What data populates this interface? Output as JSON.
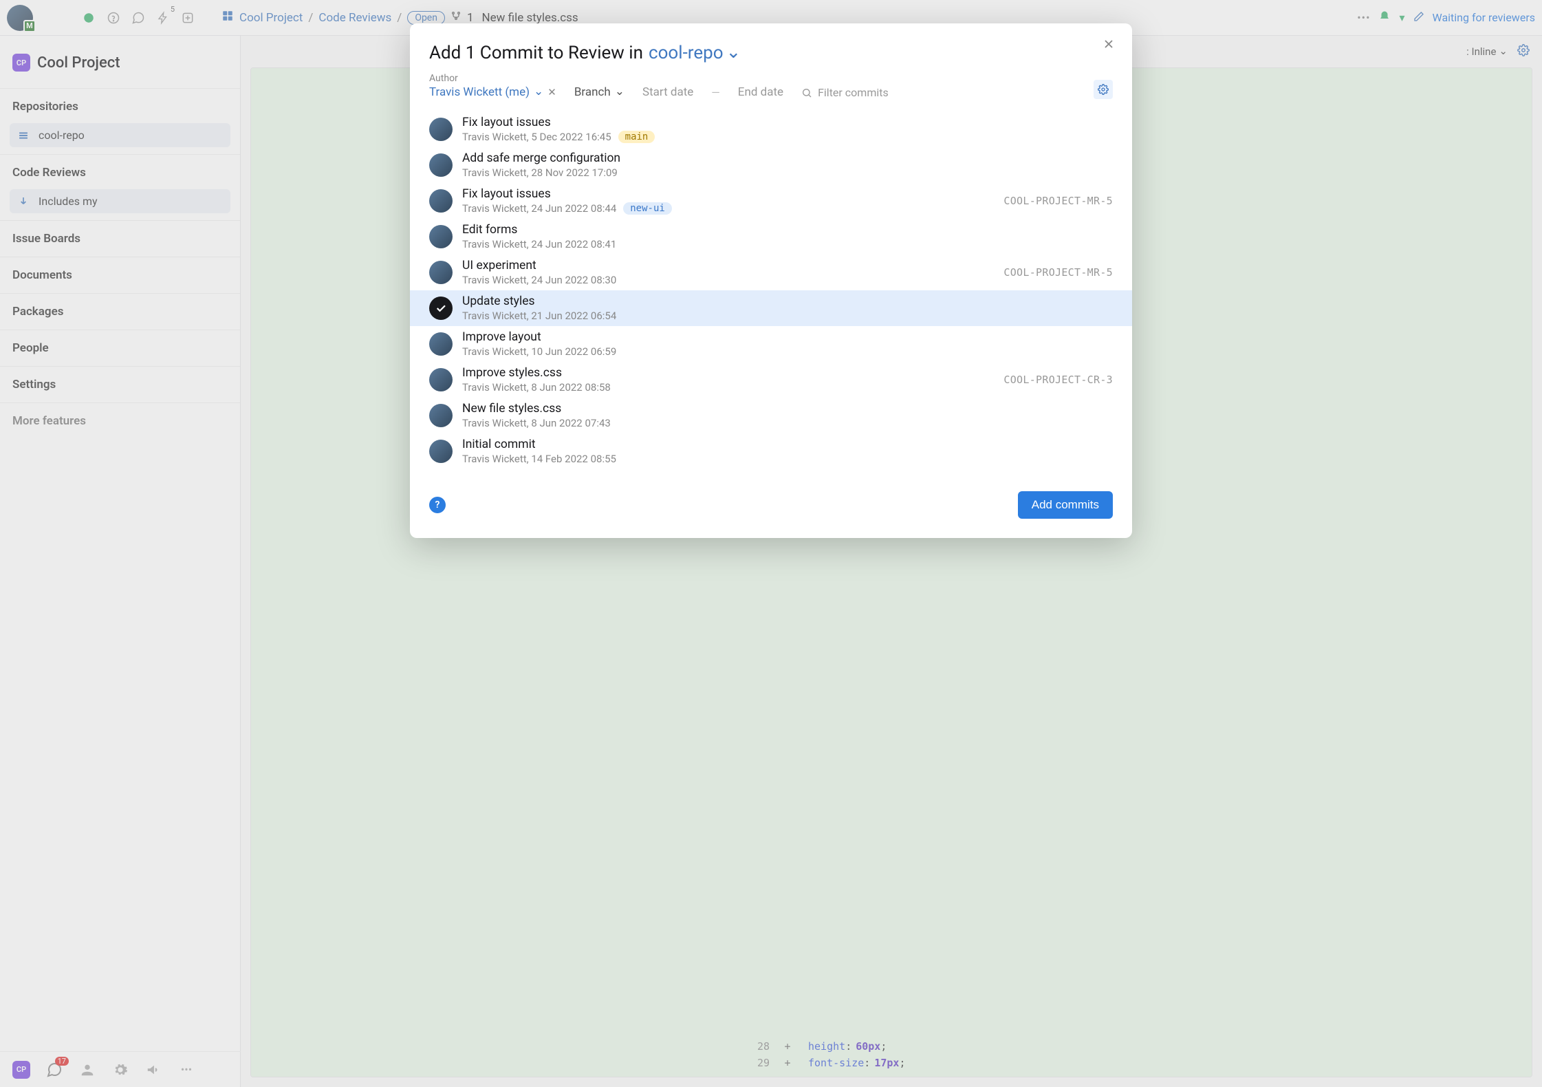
{
  "topbar": {
    "action_count": "5",
    "breadcrumb": {
      "project": "Cool Project",
      "section": "Code Reviews",
      "status": "Open",
      "icon_num": "1",
      "title": "New file styles.css"
    },
    "right_status": "Waiting for reviewers"
  },
  "sidebar": {
    "project_name": "Cool Project",
    "project_code": "CP",
    "sections": {
      "repositories": "Repositories",
      "code_reviews": "Code Reviews",
      "issue_boards": "Issue Boards",
      "documents": "Documents",
      "packages": "Packages",
      "people": "People",
      "settings": "Settings",
      "more": "More features"
    },
    "repo_item": "cool-repo",
    "review_filter": "Includes my"
  },
  "sub_toolbar": {
    "view_label": ": Inline"
  },
  "bottombar": {
    "chat_count": "17"
  },
  "modal": {
    "title_prefix": "Add 1 Commit to Review in",
    "repo": "cool-repo",
    "filters": {
      "author_label": "Author",
      "author_value": "Travis Wickett (me)",
      "branch_label": "Branch",
      "start_date": "Start date",
      "end_date": "End date",
      "filter_ph": "Filter commits"
    },
    "commits": [
      {
        "title": "Fix layout issues",
        "meta": "Travis Wickett, 5 Dec 2022 16:45",
        "tag": "main",
        "tagClass": "tag-main",
        "ref": "",
        "selected": false
      },
      {
        "title": "Add safe merge configuration",
        "meta": "Travis Wickett, 28 Nov 2022 17:09",
        "tag": "",
        "tagClass": "",
        "ref": "",
        "selected": false
      },
      {
        "title": "Fix layout issues",
        "meta": "Travis Wickett, 24 Jun 2022 08:44",
        "tag": "new-ui",
        "tagClass": "tag-newui",
        "ref": "COOL-PROJECT-MR-5",
        "selected": false
      },
      {
        "title": "Edit forms",
        "meta": "Travis Wickett, 24 Jun 2022 08:41",
        "tag": "",
        "tagClass": "",
        "ref": "",
        "selected": false
      },
      {
        "title": "UI experiment",
        "meta": "Travis Wickett, 24 Jun 2022 08:30",
        "tag": "",
        "tagClass": "",
        "ref": "COOL-PROJECT-MR-5",
        "selected": false
      },
      {
        "title": "Update styles",
        "meta": "Travis Wickett, 21 Jun 2022 06:54",
        "tag": "",
        "tagClass": "",
        "ref": "",
        "selected": true
      },
      {
        "title": "Improve layout",
        "meta": "Travis Wickett, 10 Jun 2022 06:59",
        "tag": "",
        "tagClass": "",
        "ref": "",
        "selected": false
      },
      {
        "title": "Improve styles.css",
        "meta": "Travis Wickett, 8 Jun 2022 08:58",
        "tag": "",
        "tagClass": "",
        "ref": "COOL-PROJECT-CR-3",
        "selected": false
      },
      {
        "title": "New file styles.css",
        "meta": "Travis Wickett, 8 Jun 2022 07:43",
        "tag": "",
        "tagClass": "",
        "ref": "",
        "selected": false
      },
      {
        "title": "Initial commit",
        "meta": "Travis Wickett, 14 Feb 2022 08:55",
        "tag": "",
        "tagClass": "",
        "ref": "",
        "selected": false
      }
    ],
    "submit": "Add commits"
  },
  "code": {
    "lines": [
      {
        "num": "28",
        "prop": "height",
        "val": "60px"
      },
      {
        "num": "29",
        "prop": "font-size",
        "val": "17px"
      }
    ]
  }
}
